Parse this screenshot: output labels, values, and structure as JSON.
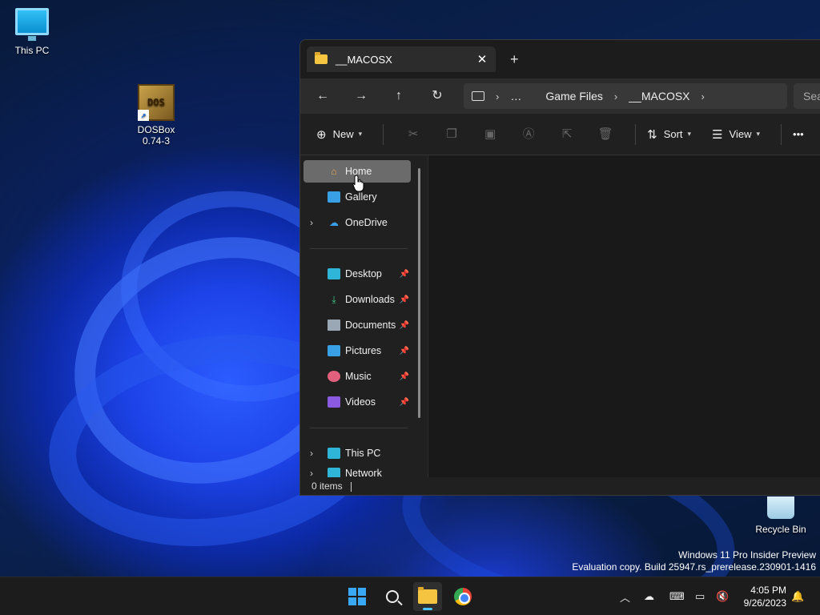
{
  "desktop": {
    "icons": [
      {
        "label": "This PC"
      },
      {
        "label": "DOSBox\n0.74-3",
        "line1": "DOSBox",
        "line2": "0.74-3"
      },
      {
        "label": "Recycle Bin"
      }
    ],
    "watermark": {
      "line1": "Windows 11 Pro Insider Preview",
      "line2": "Evaluation copy. Build 25947.rs_prerelease.230901-1416"
    }
  },
  "explorer": {
    "tab_title": "__MACOSX",
    "tab_close": "✕",
    "new_tab": "+",
    "breadcrumbs": [
      "…",
      "Game Files",
      "__MACOSX"
    ],
    "search_placeholder": "Sea",
    "commands": {
      "new_label": "New",
      "sort_label": "Sort",
      "view_label": "View",
      "more_label": "•••"
    },
    "nav": {
      "home": "Home",
      "gallery": "Gallery",
      "onedrive": "OneDrive",
      "desktop": "Desktop",
      "downloads": "Downloads",
      "documents": "Documents",
      "pictures": "Pictures",
      "music": "Music",
      "videos": "Videos",
      "thispc": "This PC",
      "network": "Network"
    },
    "status": "0 items"
  },
  "taskbar": {
    "time": "4:05 PM",
    "date": "9/26/2023"
  },
  "colors": {
    "accent": "#4cc2ff",
    "window_bg": "#202020",
    "selected_nav": "#6b6b6b"
  }
}
